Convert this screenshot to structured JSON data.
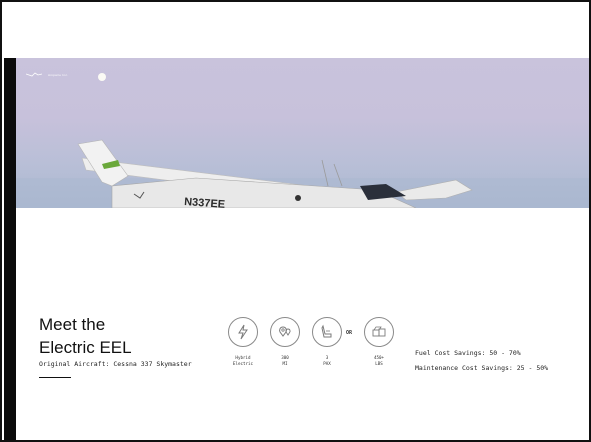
{
  "hero": {
    "brand_text": "Ampaire Inc.",
    "tail_number": "N337EE"
  },
  "title": {
    "line1": "Meet the",
    "line2": "Electric EEL"
  },
  "subtitle": "Original Aircraft: Cessna 337 Skymaster",
  "features": [
    {
      "icon": "lightning-icon",
      "line1": "Hybrid",
      "line2": "Electric"
    },
    {
      "icon": "map-pin-icon",
      "line1": "300",
      "line2": "MI"
    },
    {
      "icon": "seat-icon",
      "line1": "3",
      "line2": "PAX"
    },
    {
      "icon": "cargo-box-icon",
      "line1": "450+",
      "line2": "LBS"
    }
  ],
  "or_label": "OR",
  "savings": {
    "fuel": "Fuel Cost Savings: 50 - 70%",
    "maintenance": "Maintenance Cost Savings: 25 - 50%"
  }
}
